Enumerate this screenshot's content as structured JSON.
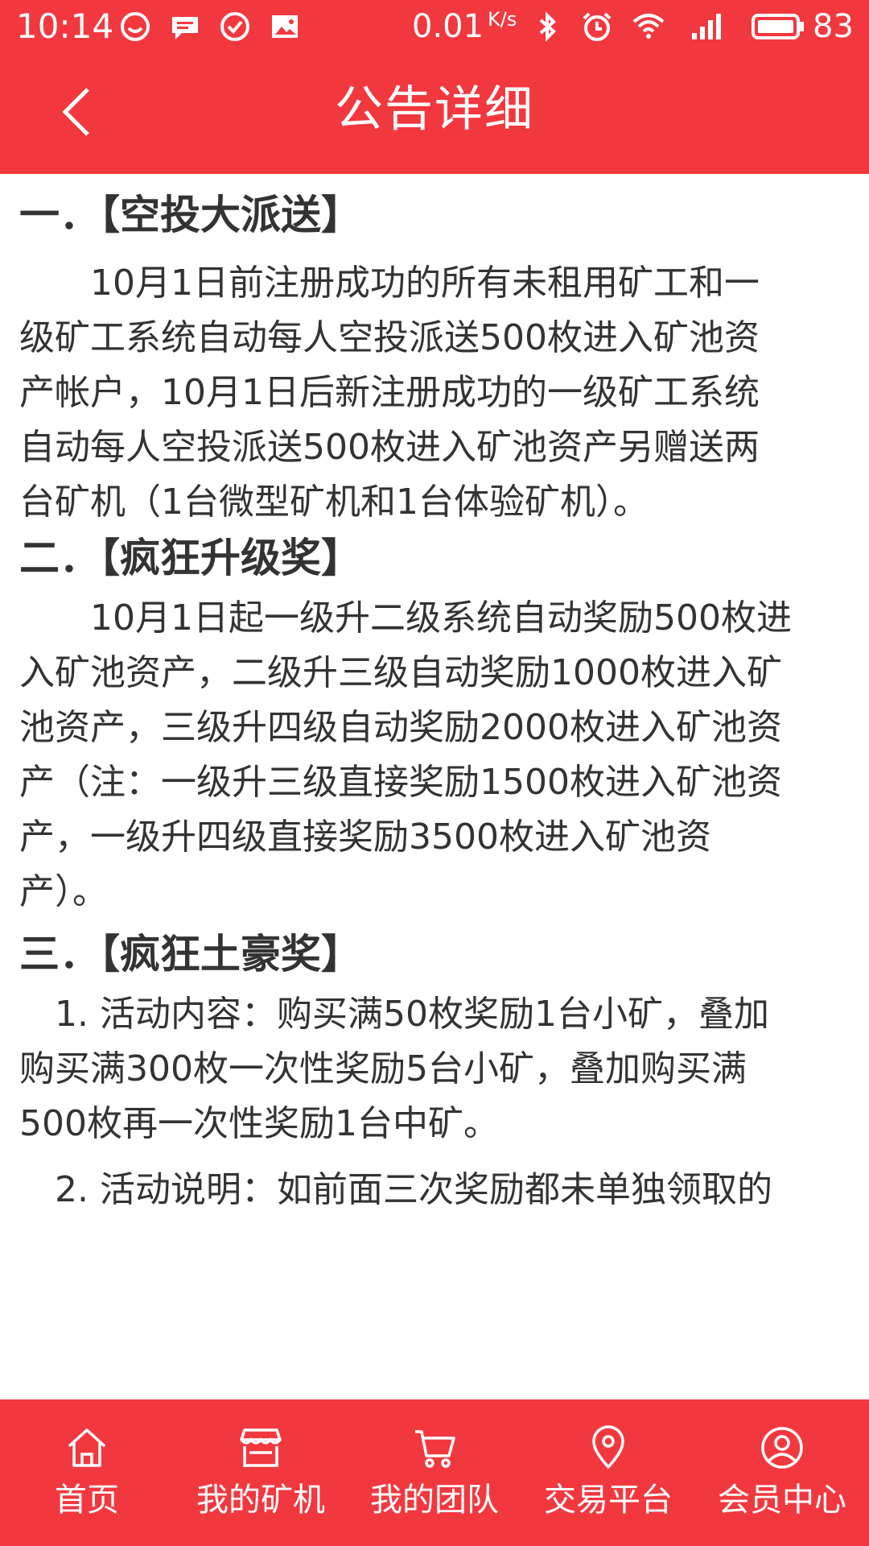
{
  "status_bar": {
    "time": "10:14",
    "net_speed": "0.01",
    "net_speed_unit": "K/s",
    "battery": "83"
  },
  "header": {
    "title": "公告详细",
    "back_icon": "chevron-left-icon"
  },
  "article": {
    "sections": [
      {
        "heading": "一．【空投大派送】",
        "lines": [
          "　　10月1日前注册成功的所有未租用矿工和一",
          "级矿工系统自动每人空投派送500枚进入矿池资",
          "产帐户，10月1日后新注册成功的一级矿工系统",
          "自动每人空投派送500枚进入矿池资产另赠送两",
          "台矿机（1台微型矿机和1台体验矿机）。"
        ]
      },
      {
        "heading": "二．【疯狂升级奖】",
        "lines": [
          "　　10月1日起一级升二级系统自动奖励500枚进",
          "入矿池资产，二级升三级自动奖励1000枚进入矿",
          "池资产，三级升四级自动奖励2000枚进入矿池资",
          "产（注：一级升三级直接奖励1500枚进入矿池资",
          "产，一级升四级直接奖励3500枚进入矿池资",
          "产）。"
        ]
      },
      {
        "heading": "三．【疯狂土豪奖】",
        "lines": [
          "　1. 活动内容：购买满50枚奖励1台小矿，叠加",
          "购买满300枚一次性奖励5台小矿，叠加购买满",
          "500枚再一次性奖励1台中矿。",
          "　2. 活动说明：如前面三次奖励都未单独领取的"
        ]
      }
    ]
  },
  "bottom_nav": {
    "items": [
      {
        "label": "首页",
        "icon": "home-icon"
      },
      {
        "label": "我的矿机",
        "icon": "store-icon"
      },
      {
        "label": "我的团队",
        "icon": "cart-icon"
      },
      {
        "label": "交易平台",
        "icon": "location-pin-icon"
      },
      {
        "label": "会员中心",
        "icon": "user-icon"
      }
    ]
  },
  "colors": {
    "primary": "#f2383f",
    "text": "#333333",
    "background": "#ffffff"
  }
}
